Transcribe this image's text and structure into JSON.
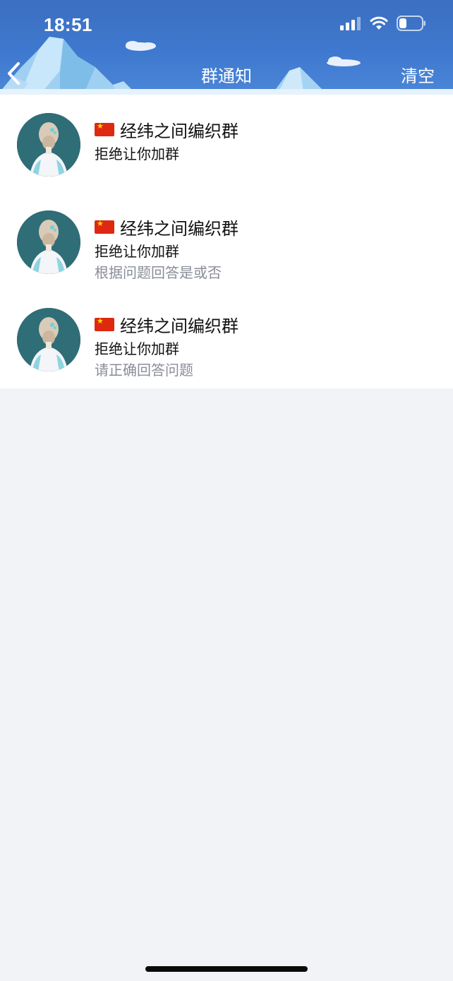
{
  "status_bar": {
    "time": "18:51",
    "icons": [
      "signal-icon",
      "wifi-icon",
      "battery-icon"
    ]
  },
  "nav": {
    "back_icon": "chevron-left-icon",
    "title": "群通知",
    "clear_label": "清空"
  },
  "notifications": [
    {
      "flag": "china-flag-icon",
      "group_name": "经纬之间编织群",
      "status": "拒绝让你加群",
      "note": ""
    },
    {
      "flag": "china-flag-icon",
      "group_name": "经纬之间编织群",
      "status": "拒绝让你加群",
      "note": "根据问题回答是或否"
    },
    {
      "flag": "china-flag-icon",
      "group_name": "经纬之间编织群",
      "status": "拒绝让你加群",
      "note": "请正确回答问题"
    }
  ],
  "colors": {
    "header_blue": "#3f79cf",
    "background": "#f2f3f7",
    "note_gray": "#8a8d99"
  }
}
